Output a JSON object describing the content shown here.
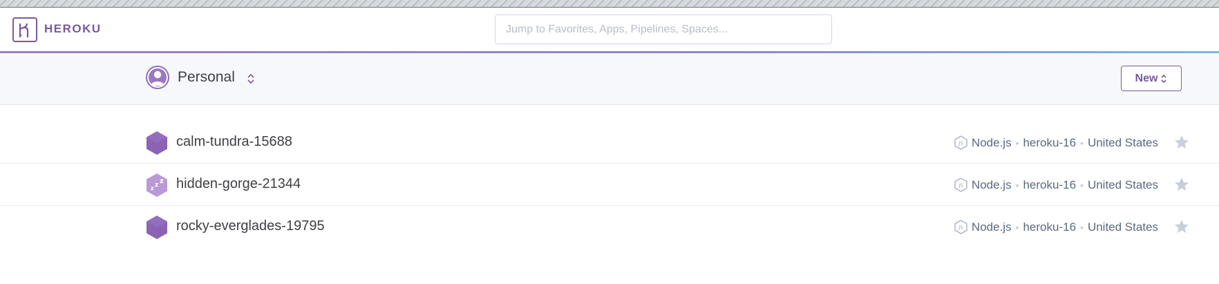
{
  "header": {
    "logo_text": "HEROKU",
    "search_placeholder": "Jump to Favorites, Apps, Pipelines, Spaces..."
  },
  "account": {
    "name": "Personal",
    "new_button_label": "New"
  },
  "apps": [
    {
      "name": "calm-tundra-15688",
      "status": "running",
      "language": "Node.js",
      "stack": "heroku-16",
      "region": "United States"
    },
    {
      "name": "hidden-gorge-21344",
      "status": "sleeping",
      "language": "Node.js",
      "stack": "heroku-16",
      "region": "United States"
    },
    {
      "name": "rocky-everglades-19795",
      "status": "running",
      "language": "Node.js",
      "stack": "heroku-16",
      "region": "United States"
    }
  ],
  "colors": {
    "brand_purple": "#79589f",
    "app_hex_running": "#8a63b5",
    "app_hex_sleeping": "#b99ad6",
    "star_idle": "#c9cfda"
  },
  "icons": {
    "logo": "heroku-logo-icon",
    "avatar": "user-avatar-icon",
    "switcher": "chevron-up-down-icon",
    "app_running": "hexagon-icon",
    "app_sleeping": "sleeping-hexagon-icon",
    "language": "nodejs-icon",
    "favorite": "star-icon"
  }
}
